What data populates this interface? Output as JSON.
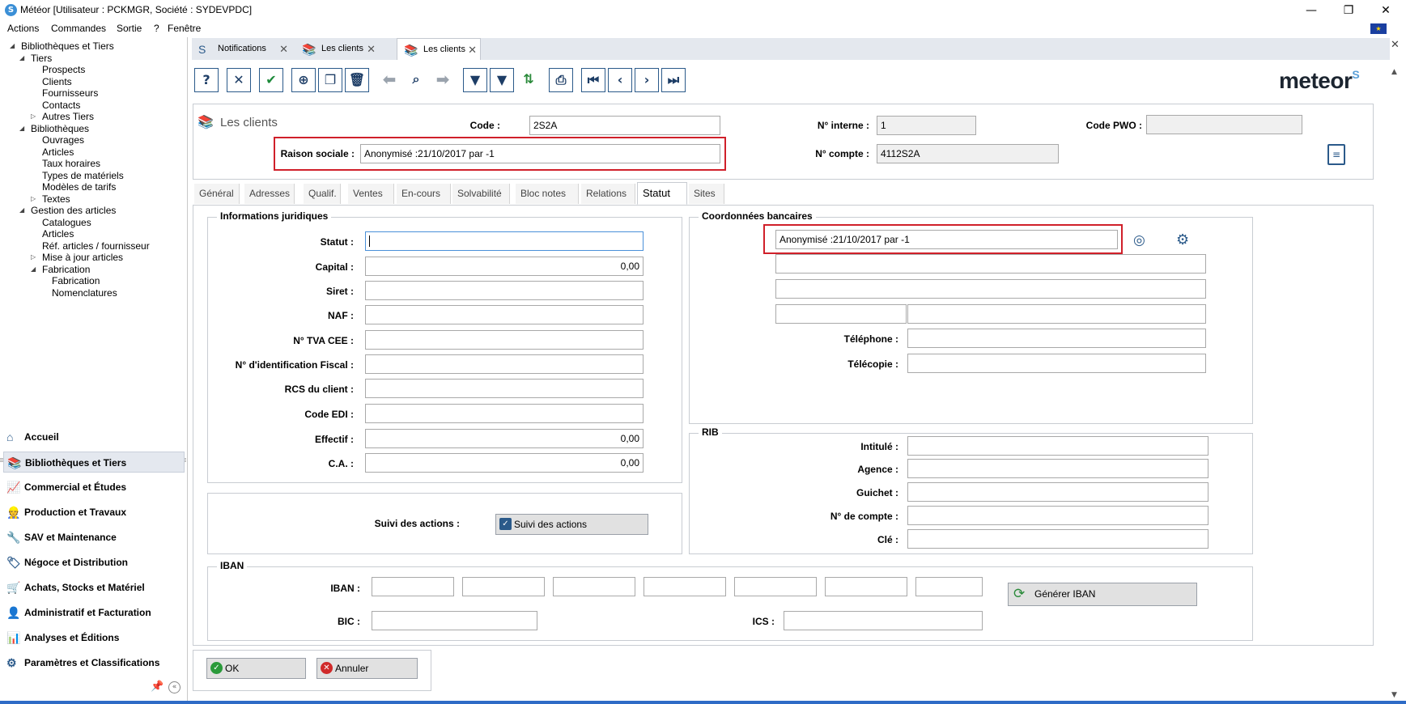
{
  "window": {
    "title": "Météor [Utilisateur : PCKMGR, Société : SYDEVPDC]",
    "minimize": "—",
    "restore": "❐",
    "close": "✕"
  },
  "menu": [
    "Actions",
    "Commandes",
    "Sortie",
    "?",
    "Fenêtre"
  ],
  "tree": [
    {
      "label": "Bibliothèques et Tiers",
      "level": 0,
      "expanded": true
    },
    {
      "label": "Tiers",
      "level": 1,
      "expanded": true
    },
    {
      "label": "Prospects",
      "level": 2
    },
    {
      "label": "Clients",
      "level": 2
    },
    {
      "label": "Fournisseurs",
      "level": 2
    },
    {
      "label": "Contacts",
      "level": 2
    },
    {
      "label": "Autres Tiers",
      "level": 2,
      "expanded": false
    },
    {
      "label": "Bibliothèques",
      "level": 1,
      "expanded": true
    },
    {
      "label": "Ouvrages",
      "level": 2
    },
    {
      "label": "Articles",
      "level": 2
    },
    {
      "label": "Taux horaires",
      "level": 2
    },
    {
      "label": "Types de matériels",
      "level": 2
    },
    {
      "label": "Modèles de tarifs",
      "level": 2
    },
    {
      "label": "Textes",
      "level": 2,
      "expanded": false
    },
    {
      "label": "Gestion des articles",
      "level": 1,
      "expanded": true
    },
    {
      "label": "Catalogues",
      "level": 2
    },
    {
      "label": "Articles",
      "level": 2
    },
    {
      "label": "Réf. articles / fournisseur",
      "level": 2
    },
    {
      "label": "Mise à jour articles",
      "level": 2,
      "expanded": false
    },
    {
      "label": "Fabrication",
      "level": 2,
      "expanded": true
    },
    {
      "label": "Fabrication",
      "level": 3
    },
    {
      "label": "Nomenclatures",
      "level": 3
    }
  ],
  "nav": [
    {
      "label": "Accueil",
      "icon": "home-icon",
      "active": false
    },
    {
      "label": "Bibliothèques et Tiers",
      "icon": "books-icon",
      "active": true
    },
    {
      "label": "Commercial et Études",
      "icon": "chart-icon",
      "active": false
    },
    {
      "label": "Production et Travaux",
      "icon": "worker-icon",
      "active": false
    },
    {
      "label": "SAV et Maintenance",
      "icon": "wrench-icon",
      "active": false
    },
    {
      "label": "Négoce et Distribution",
      "icon": "tag-icon",
      "active": false
    },
    {
      "label": "Achats, Stocks et Matériel",
      "icon": "cart-icon",
      "active": false
    },
    {
      "label": "Administratif et Facturation",
      "icon": "admin-icon",
      "active": false
    },
    {
      "label": "Analyses et Éditions",
      "icon": "report-icon",
      "active": false
    },
    {
      "label": "Paramètres et Classifications",
      "icon": "settings-icon",
      "active": false
    }
  ],
  "tabs": [
    {
      "label": "Notifications",
      "active": false
    },
    {
      "label": "Les clients",
      "active": false
    },
    {
      "label": "Les clients",
      "active": true
    }
  ],
  "logo": "meteor",
  "header": {
    "title": "Les clients",
    "code_label": "Code :",
    "code_value": "2S2A",
    "raison_label": "Raison sociale :",
    "raison_value": "Anonymisé :21/10/2017 par -1",
    "interne_label": "N° interne :",
    "interne_value": "1",
    "compte_label": "N° compte :",
    "compte_value": "4112S2A",
    "pwo_label": "Code PWO :",
    "pwo_value": ""
  },
  "form_tabs": [
    "Général",
    "Adresses",
    "Qualif.",
    "Ventes",
    "En-cours",
    "Solvabilité",
    "Bloc notes",
    "Relations",
    "Statut",
    "Sites"
  ],
  "juridique": {
    "title": "Informations juridiques",
    "fields": [
      {
        "label": "Statut :",
        "value": ""
      },
      {
        "label": "Capital :",
        "value": "0,00"
      },
      {
        "label": "Siret :",
        "value": ""
      },
      {
        "label": "NAF :",
        "value": ""
      },
      {
        "label": "N° TVA CEE :",
        "value": ""
      },
      {
        "label": "N° d'identification Fiscal :",
        "value": ""
      },
      {
        "label": "RCS du client :",
        "value": ""
      },
      {
        "label": "Code EDI :",
        "value": ""
      },
      {
        "label": "Effectif :",
        "value": "0,00"
      },
      {
        "label": "C.A. :",
        "value": "0,00"
      }
    ]
  },
  "suivi": {
    "label": "Suivi des actions :",
    "button": "Suivi des actions"
  },
  "bancaires": {
    "title": "Coordonnées bancaires",
    "name_value": "Anonymisé :21/10/2017 par -1",
    "tel_label": "Téléphone :",
    "fax_label": "Télécopie :"
  },
  "rib": {
    "title": "RIB",
    "fields": [
      {
        "label": "Intitulé :",
        "value": ""
      },
      {
        "label": "Agence :",
        "value": ""
      },
      {
        "label": "Guichet :",
        "value": ""
      },
      {
        "label": "N° de compte :",
        "value": ""
      },
      {
        "label": "Clé :",
        "value": ""
      }
    ]
  },
  "iban": {
    "title": "IBAN",
    "iban_label": "IBAN :",
    "bic_label": "BIC :",
    "ics_label": "ICS :",
    "generate_button": "Générer IBAN"
  },
  "footer": {
    "ok": "OK",
    "cancel": "Annuler"
  }
}
